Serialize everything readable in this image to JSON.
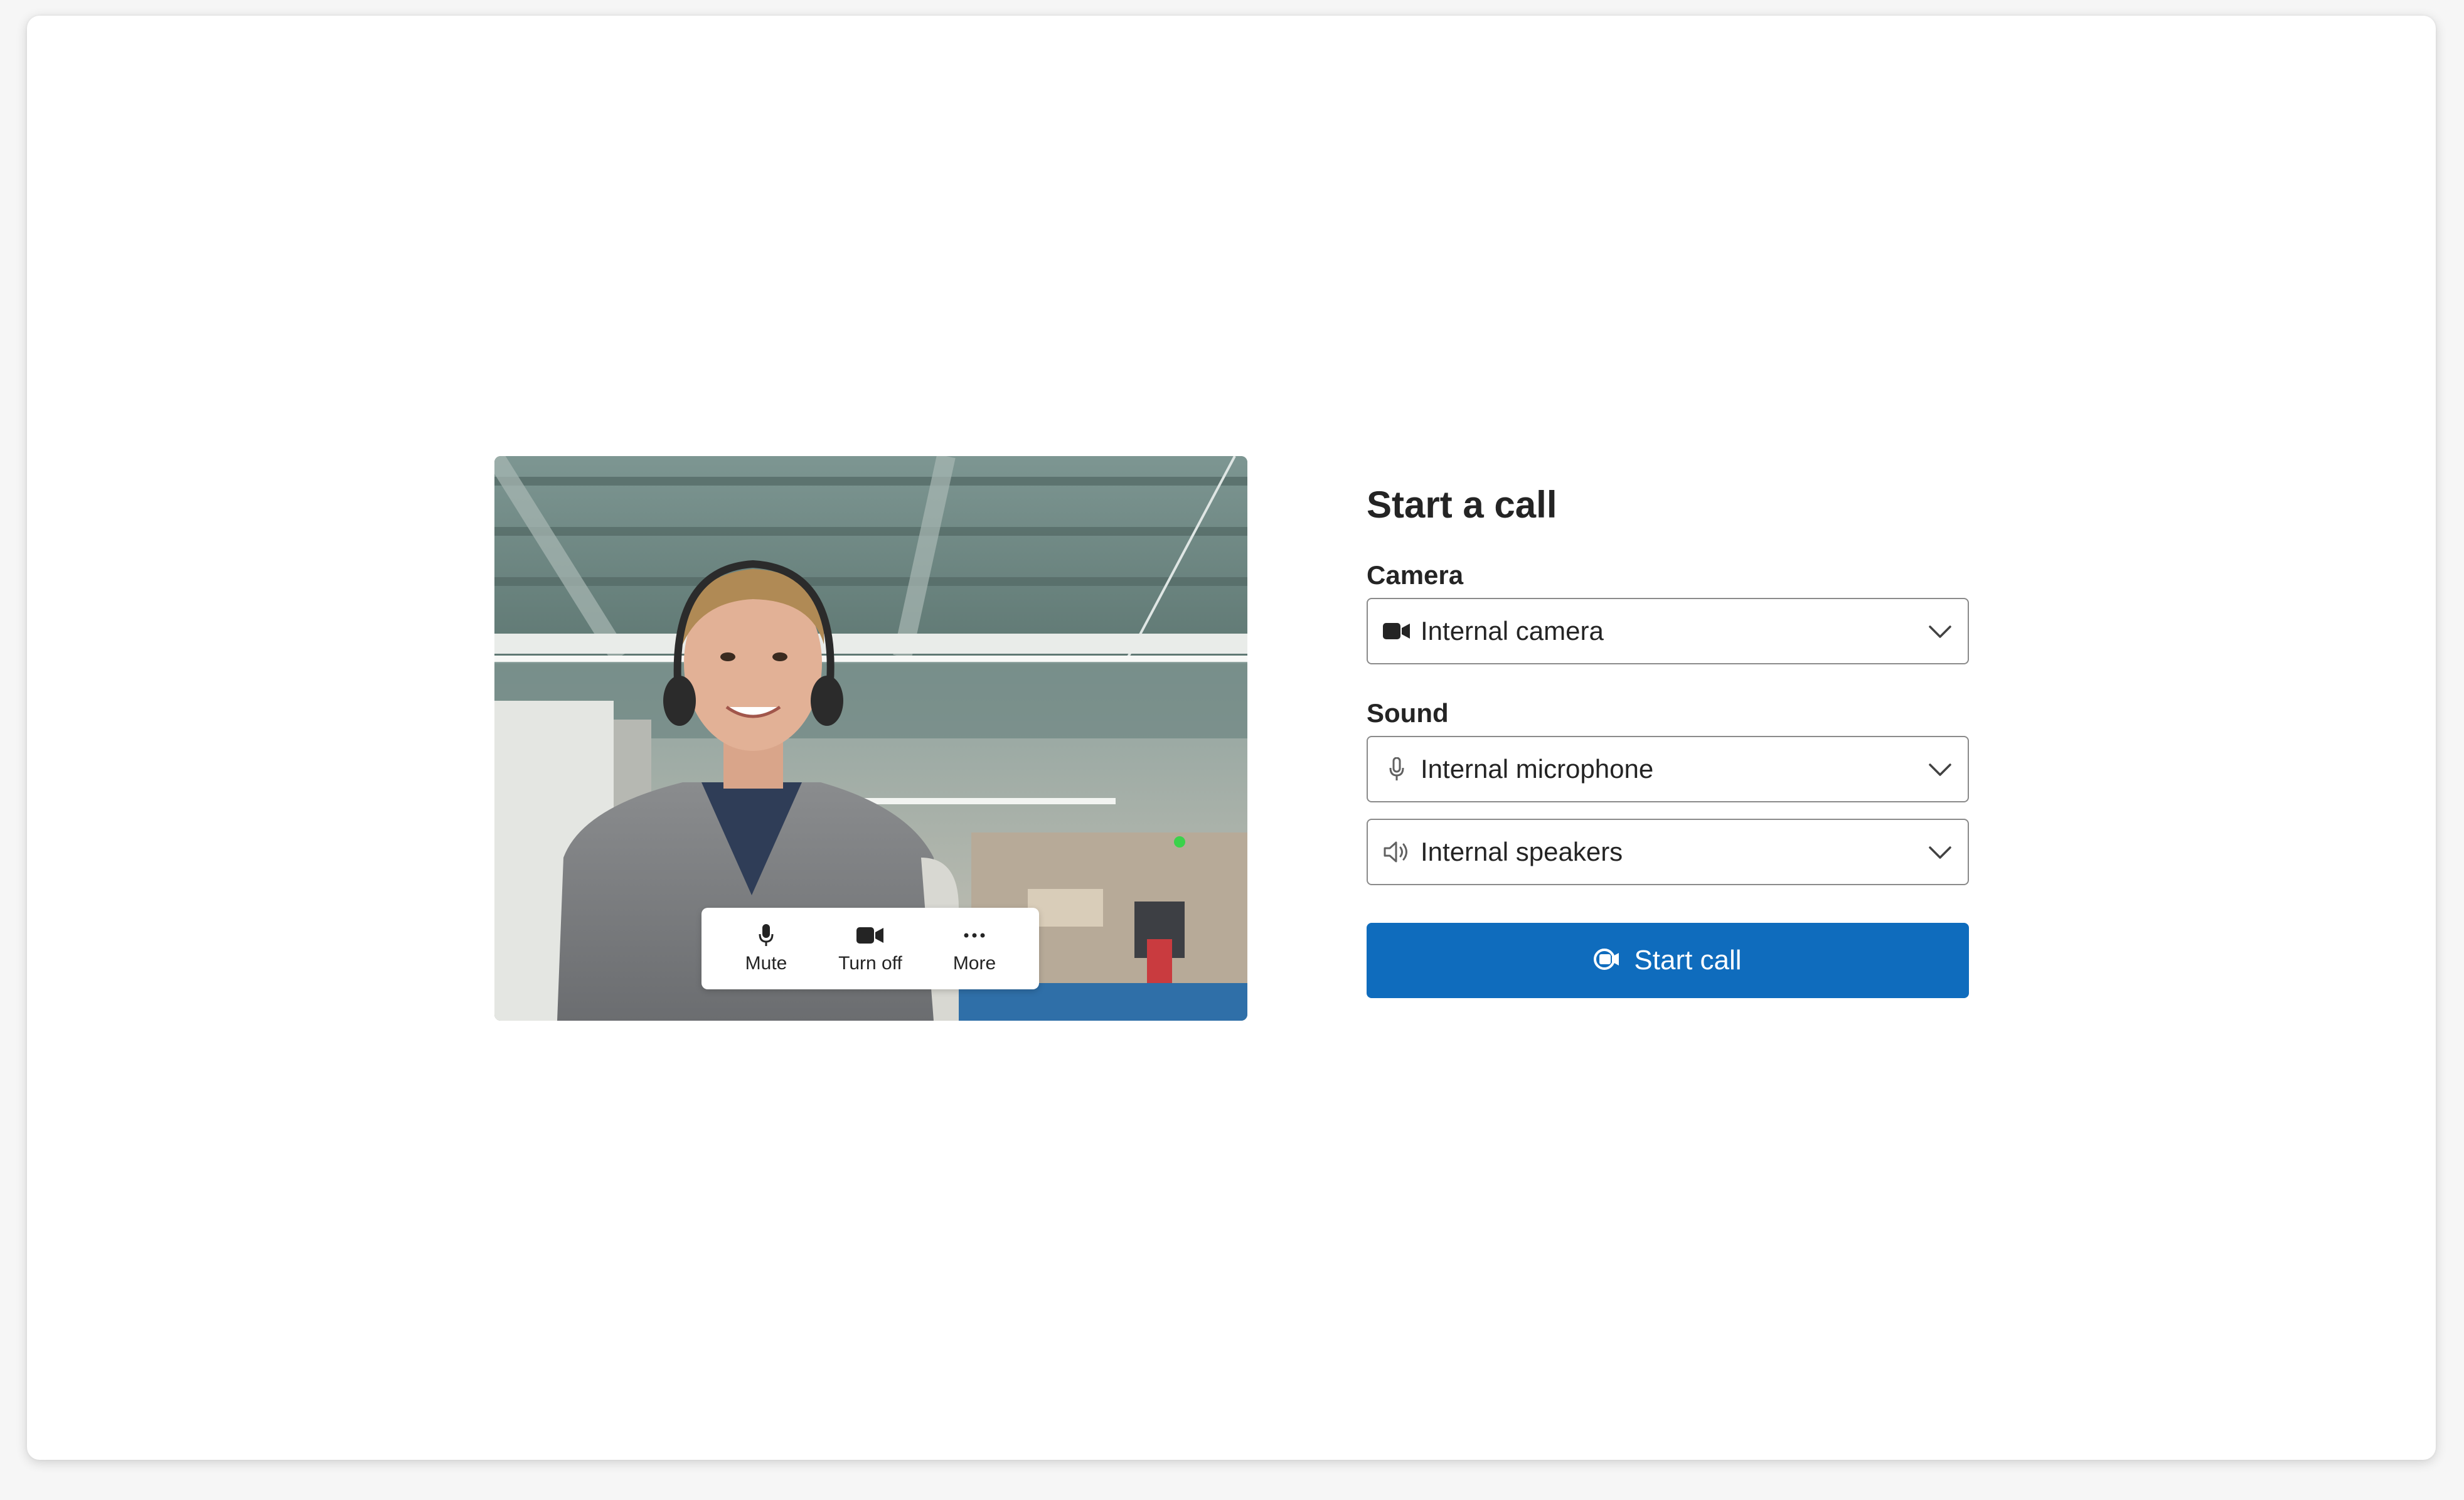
{
  "preview": {
    "image_description_icon": "video-preview-image",
    "controls": [
      {
        "label": "Mute",
        "icon": "microphone-icon"
      },
      {
        "label": "Turn off",
        "icon": "video-camera-icon"
      },
      {
        "label": "More",
        "icon": "more-horizontal-icon"
      }
    ]
  },
  "panel": {
    "title": "Start a call",
    "camera_label": "Camera",
    "camera_value": "Internal camera",
    "sound_label": "Sound",
    "microphone_value": "Internal microphone",
    "speaker_value": "Internal speakers",
    "start_button_label": "Start call"
  },
  "colors": {
    "accent": "#0f6cbd",
    "text": "#242424",
    "border": "#8a8a8a"
  }
}
